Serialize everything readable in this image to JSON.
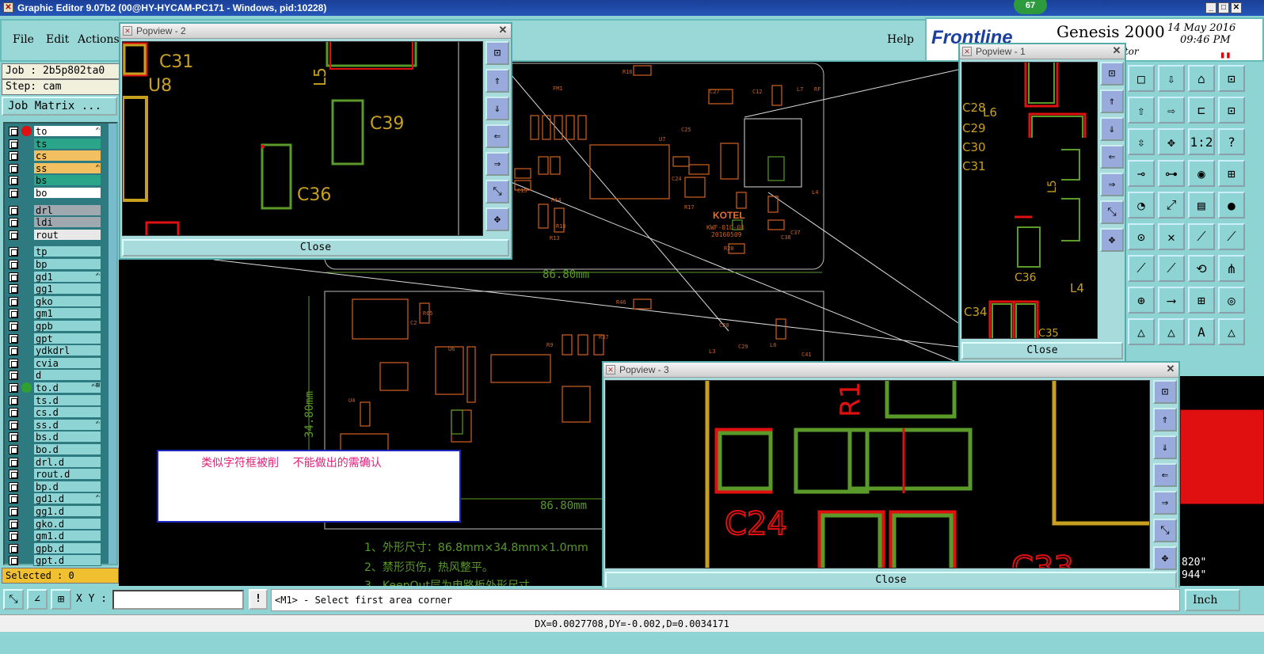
{
  "window": {
    "title": "Graphic Editor 9.07b2 (00@HY-HYCAM-PC171 - Windows, pid:10228)",
    "badge": "67"
  },
  "menu": {
    "file": "File",
    "edit": "Edit",
    "actions": "Actions",
    "help": "Help"
  },
  "brand": {
    "logo": "Frontline",
    "product": "Genesis 2000",
    "date": "14 May 2016",
    "time": "09:46 PM",
    "sub": "itor"
  },
  "job": {
    "job_label": "Job : 2b5p802ta0",
    "step_label": "Step: cam",
    "matrix_button": "Job Matrix ..."
  },
  "layers": [
    {
      "name": "to",
      "color": "#ffffff",
      "dot": "#e01010",
      "flag": "✍"
    },
    {
      "name": "ts",
      "color": "#2aa58a",
      "dot": "",
      "flag": ""
    },
    {
      "name": "cs",
      "color": "#f2c060",
      "dot": "",
      "flag": ""
    },
    {
      "name": "ss",
      "color": "#f2c060",
      "dot": "",
      "flag": "✍"
    },
    {
      "name": "bs",
      "color": "#2aa58a",
      "dot": "",
      "flag": ""
    },
    {
      "name": "bo",
      "color": "#ffffff",
      "dot": "",
      "flag": ""
    },
    {
      "name": "drl",
      "color": "#a0a8b0",
      "dot": "",
      "flag": ""
    },
    {
      "name": "ldi",
      "color": "#a0a8b0",
      "dot": "",
      "flag": ""
    },
    {
      "name": "rout",
      "color": "#e8e8e8",
      "dot": "",
      "flag": ""
    },
    {
      "name": "tp",
      "color": "",
      "dot": "",
      "flag": ""
    },
    {
      "name": "bp",
      "color": "",
      "dot": "",
      "flag": ""
    },
    {
      "name": "gd1",
      "color": "",
      "dot": "",
      "flag": "✍"
    },
    {
      "name": "gg1",
      "color": "",
      "dot": "",
      "flag": ""
    },
    {
      "name": "gko",
      "color": "",
      "dot": "",
      "flag": ""
    },
    {
      "name": "gm1",
      "color": "",
      "dot": "",
      "flag": ""
    },
    {
      "name": "gpb",
      "color": "",
      "dot": "",
      "flag": ""
    },
    {
      "name": "gpt",
      "color": "",
      "dot": "",
      "flag": ""
    },
    {
      "name": "ydkdrl",
      "color": "",
      "dot": "",
      "flag": ""
    },
    {
      "name": "cvia",
      "color": "",
      "dot": "",
      "flag": ""
    },
    {
      "name": "d",
      "color": "",
      "dot": "",
      "flag": ""
    },
    {
      "name": "to.d",
      "color": "",
      "dot": "#30a030",
      "flag": "✍⊞"
    },
    {
      "name": "ts.d",
      "color": "",
      "dot": "",
      "flag": ""
    },
    {
      "name": "cs.d",
      "color": "",
      "dot": "",
      "flag": ""
    },
    {
      "name": "ss.d",
      "color": "",
      "dot": "",
      "flag": "✍"
    },
    {
      "name": "bs.d",
      "color": "",
      "dot": "",
      "flag": ""
    },
    {
      "name": "bo.d",
      "color": "",
      "dot": "",
      "flag": ""
    },
    {
      "name": "drl.d",
      "color": "",
      "dot": "",
      "flag": ""
    },
    {
      "name": "rout.d",
      "color": "",
      "dot": "",
      "flag": ""
    },
    {
      "name": "bp.d",
      "color": "",
      "dot": "",
      "flag": ""
    },
    {
      "name": "gd1.d",
      "color": "",
      "dot": "",
      "flag": "✍"
    },
    {
      "name": "gg1.d",
      "color": "",
      "dot": "",
      "flag": ""
    },
    {
      "name": "gko.d",
      "color": "",
      "dot": "",
      "flag": ""
    },
    {
      "name": "gm1.d",
      "color": "",
      "dot": "",
      "flag": ""
    },
    {
      "name": "gpb.d",
      "color": "",
      "dot": "",
      "flag": ""
    },
    {
      "name": "gpt.d",
      "color": "",
      "dot": "",
      "flag": ""
    }
  ],
  "selected": "Selected : 0",
  "canvas": {
    "labels": [
      "FM1",
      "R16",
      "C27",
      "C12",
      "L7",
      "RF",
      "U7",
      "C25",
      "KOTEL",
      "KWF-01C-01",
      "20160509",
      "R20",
      "C37",
      "C38",
      "C24",
      "C15",
      "R17",
      "R18",
      "R13",
      "R14",
      "U8",
      "L4",
      "R46",
      "C2",
      "R65",
      "U6",
      "U4",
      "R37",
      "C28",
      "C29",
      "L6",
      "C41",
      "L3",
      "R9"
    ],
    "dim_top": "86.80mm",
    "dim_bottom": "86.80mm",
    "dim_left": "34.80mm",
    "notes": [
      "1、外形尺寸：86.8mm×34.8mm×1.0mm",
      "2、禁形页伤，热风整平。",
      "3、KeepOut层为电路板外形尺寸"
    ]
  },
  "annotation": {
    "text": "类似字符框被削    不能做出的需确认"
  },
  "popview2": {
    "title": "Popview - 2",
    "close": "Close",
    "labels": [
      "C31",
      "U8",
      "L5",
      "C39",
      "C36"
    ]
  },
  "popview1": {
    "title": "Popview - 1",
    "close": "Close",
    "labels": [
      "C28",
      "L6",
      "C29",
      "C30",
      "C31",
      "L5",
      "C36",
      "L4",
      "C34",
      "C35"
    ]
  },
  "popview3": {
    "title": "Popview - 3",
    "close": "Close",
    "labels": [
      "R1",
      "C24",
      "C33"
    ]
  },
  "right_panel": {
    "coord1": "820\"",
    "coord2": "944\"",
    "units": "Inch"
  },
  "bottom": {
    "xy_label": "X Y :",
    "xy_value": "",
    "prompt": "<M1> - Select first area corner"
  },
  "status": {
    "text": "DX=0.0027708,DY=-0.002,D=0.0034171"
  },
  "colors": {
    "accent": "#8fd4d4",
    "titlebar": "#1a3f98",
    "pcb_green": "#5a9a2a",
    "pcb_red": "#e01010",
    "pcb_orange": "#d06020"
  }
}
